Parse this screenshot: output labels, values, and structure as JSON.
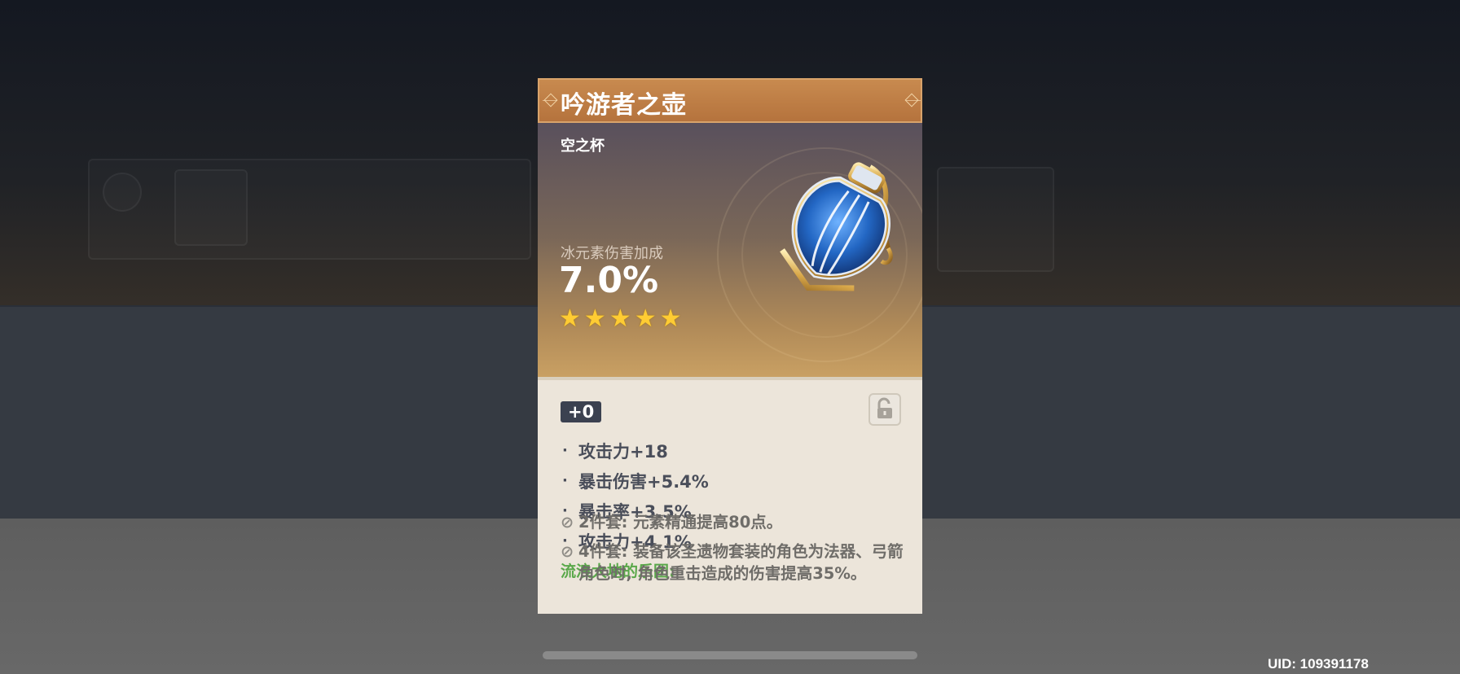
{
  "artifact": {
    "name": "吟游者之壶",
    "slot": "空之杯",
    "main_stat": {
      "name": "冰元素伤害加成",
      "value": "7.0%"
    },
    "rarity_stars": 5,
    "level": "+0",
    "substats": [
      {
        "bullet": "·",
        "text": "攻击力+18"
      },
      {
        "bullet": "·",
        "text": "暴击伤害+5.4%"
      },
      {
        "bullet": "·",
        "text": "暴击率+3.5%"
      },
      {
        "bullet": "·",
        "text": "攻击力+4.1%"
      }
    ],
    "set": {
      "name": "流浪大地的乐团:",
      "bonuses": [
        {
          "text": "2件套: 元素精通提高80点。"
        },
        {
          "text": "4件套: 装备该圣遗物套装的角色为法器、弓箭角色时, 角色重击造成的伤害提高35%。"
        }
      ]
    },
    "icons": {
      "lock": "unlocked-padlock-icon",
      "set_inactive": "slashed-circle-icon",
      "star": "star-icon"
    },
    "colors": {
      "header": "#b5733d",
      "set_name": "#5aa84a",
      "star": "#ffcc33",
      "level_badge": "#3b4150"
    }
  },
  "footer": {
    "uid": "UID: 109391178"
  }
}
